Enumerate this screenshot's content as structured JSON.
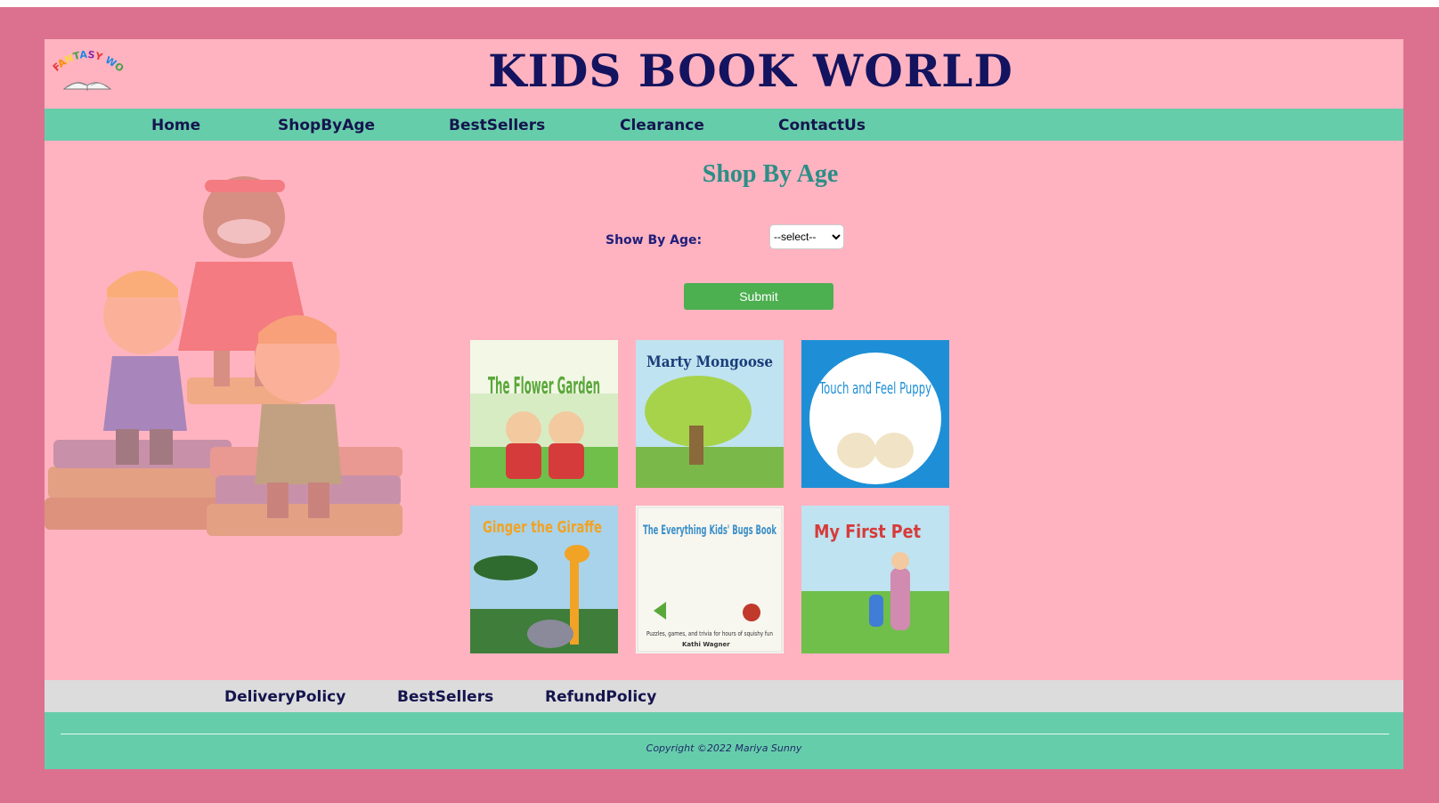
{
  "header": {
    "site_title": "KIDS BOOK WORLD",
    "logo_text": "FANTASY WORLD"
  },
  "nav": {
    "items": [
      {
        "label": "Home"
      },
      {
        "label": "ShopByAge"
      },
      {
        "label": "BestSellers"
      },
      {
        "label": "Clearance"
      },
      {
        "label": "ContactUs"
      }
    ]
  },
  "main": {
    "title": "Shop By Age",
    "age_label": "Show By Age:",
    "age_select_value": "--select--",
    "submit_label": "Submit"
  },
  "books": [
    {
      "title": "The Flower Garden"
    },
    {
      "title": "Marty Mongoose"
    },
    {
      "title": "Touch and Feel Puppy"
    },
    {
      "title": "Ginger the Giraffe"
    },
    {
      "title": "The Everything Kids' Bugs Book",
      "subtitle": "Puzzles, games, and trivia for hours of squishy fun",
      "author": "Kathi Wagner"
    },
    {
      "title": "My First Pet"
    }
  ],
  "footer": {
    "links": [
      {
        "label": "DeliveryPolicy"
      },
      {
        "label": "BestSellers"
      },
      {
        "label": "RefundPolicy"
      }
    ],
    "copyright": "Copyright ©2022 Mariya Sunny"
  },
  "colors": {
    "frame": "#dc718f",
    "page_bg": "#ffb3c0",
    "nav_bg": "#66cdaa",
    "footer_links_bg": "#dcdcdc",
    "title_color": "#14135f",
    "section_title": "#2c8e87",
    "submit_bg": "#4caf50"
  }
}
